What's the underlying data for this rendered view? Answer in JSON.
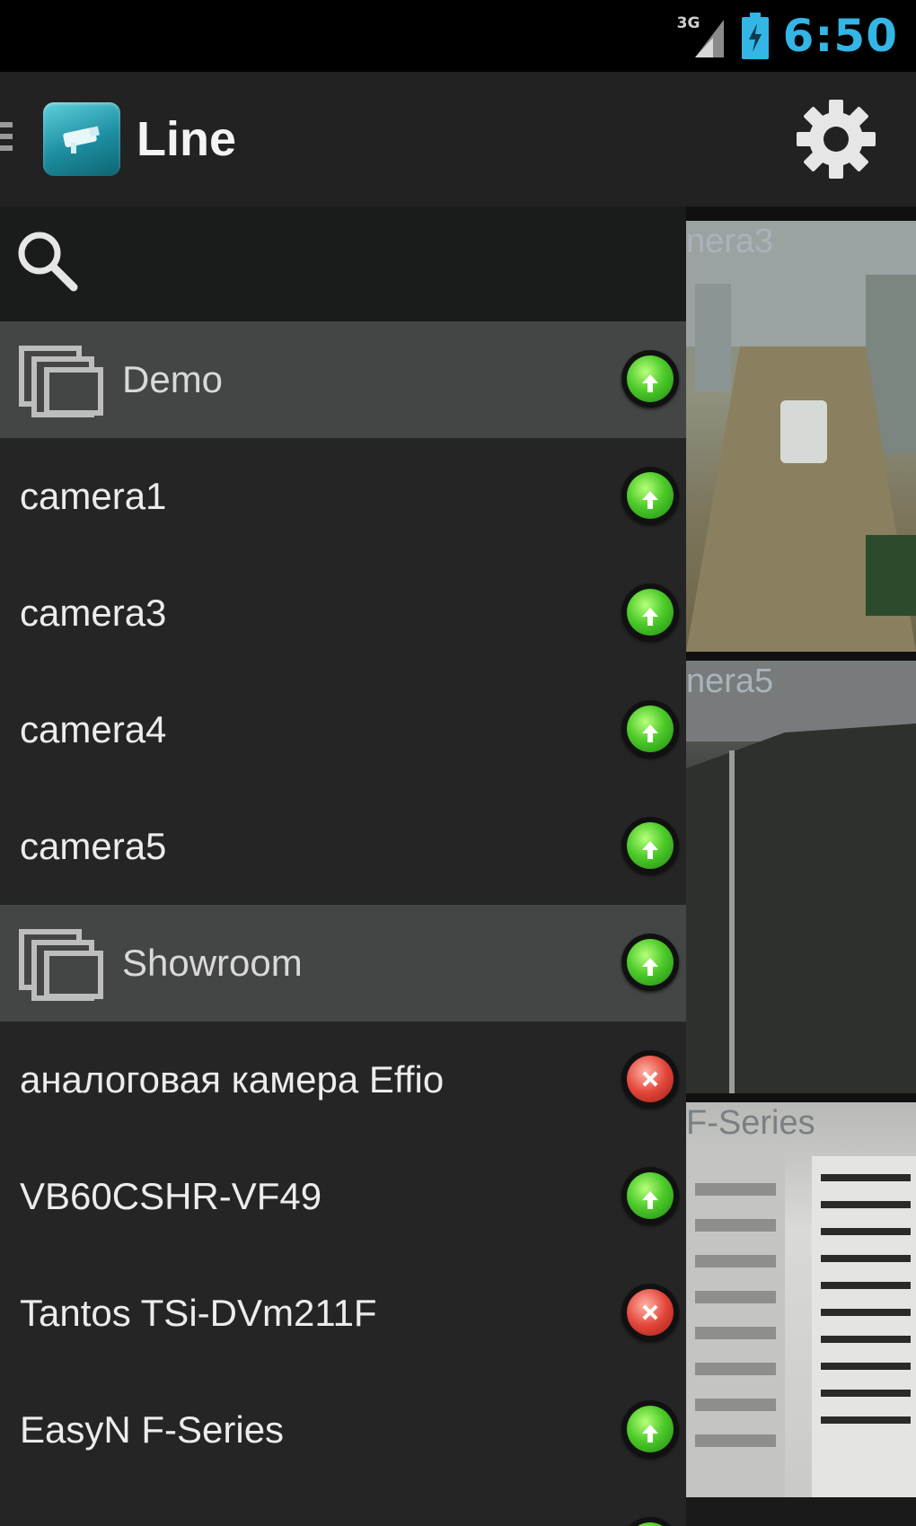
{
  "status_bar": {
    "network": "3G",
    "time": "6:50"
  },
  "action_bar": {
    "title": "Line",
    "settings_icon": "gear-icon",
    "logo_icon": "camera-logo-icon"
  },
  "search": {
    "icon": "search-icon"
  },
  "preview": {
    "tiles": [
      {
        "label": "nera3"
      },
      {
        "label": "nera5"
      },
      {
        "label": "F-Series"
      }
    ]
  },
  "list": {
    "groups": [
      {
        "name": "Demo",
        "status": "online",
        "cameras": [
          {
            "name": "camera1",
            "status": "online"
          },
          {
            "name": "camera3",
            "status": "online"
          },
          {
            "name": "camera4",
            "status": "online"
          },
          {
            "name": "camera5",
            "status": "online"
          }
        ]
      },
      {
        "name": "Showroom",
        "status": "online",
        "cameras": [
          {
            "name": "аналоговая камера Effio",
            "status": "offline"
          },
          {
            "name": "VB60CSHR-VF49",
            "status": "online"
          },
          {
            "name": "Tantos TSi-DVm211F",
            "status": "offline"
          },
          {
            "name": "EasyN F-Series",
            "status": "online"
          }
        ]
      }
    ]
  },
  "colors": {
    "clock": "#33b5e5",
    "online": "#4ecb2a",
    "offline": "#e3463a",
    "group_row": "#444545"
  }
}
